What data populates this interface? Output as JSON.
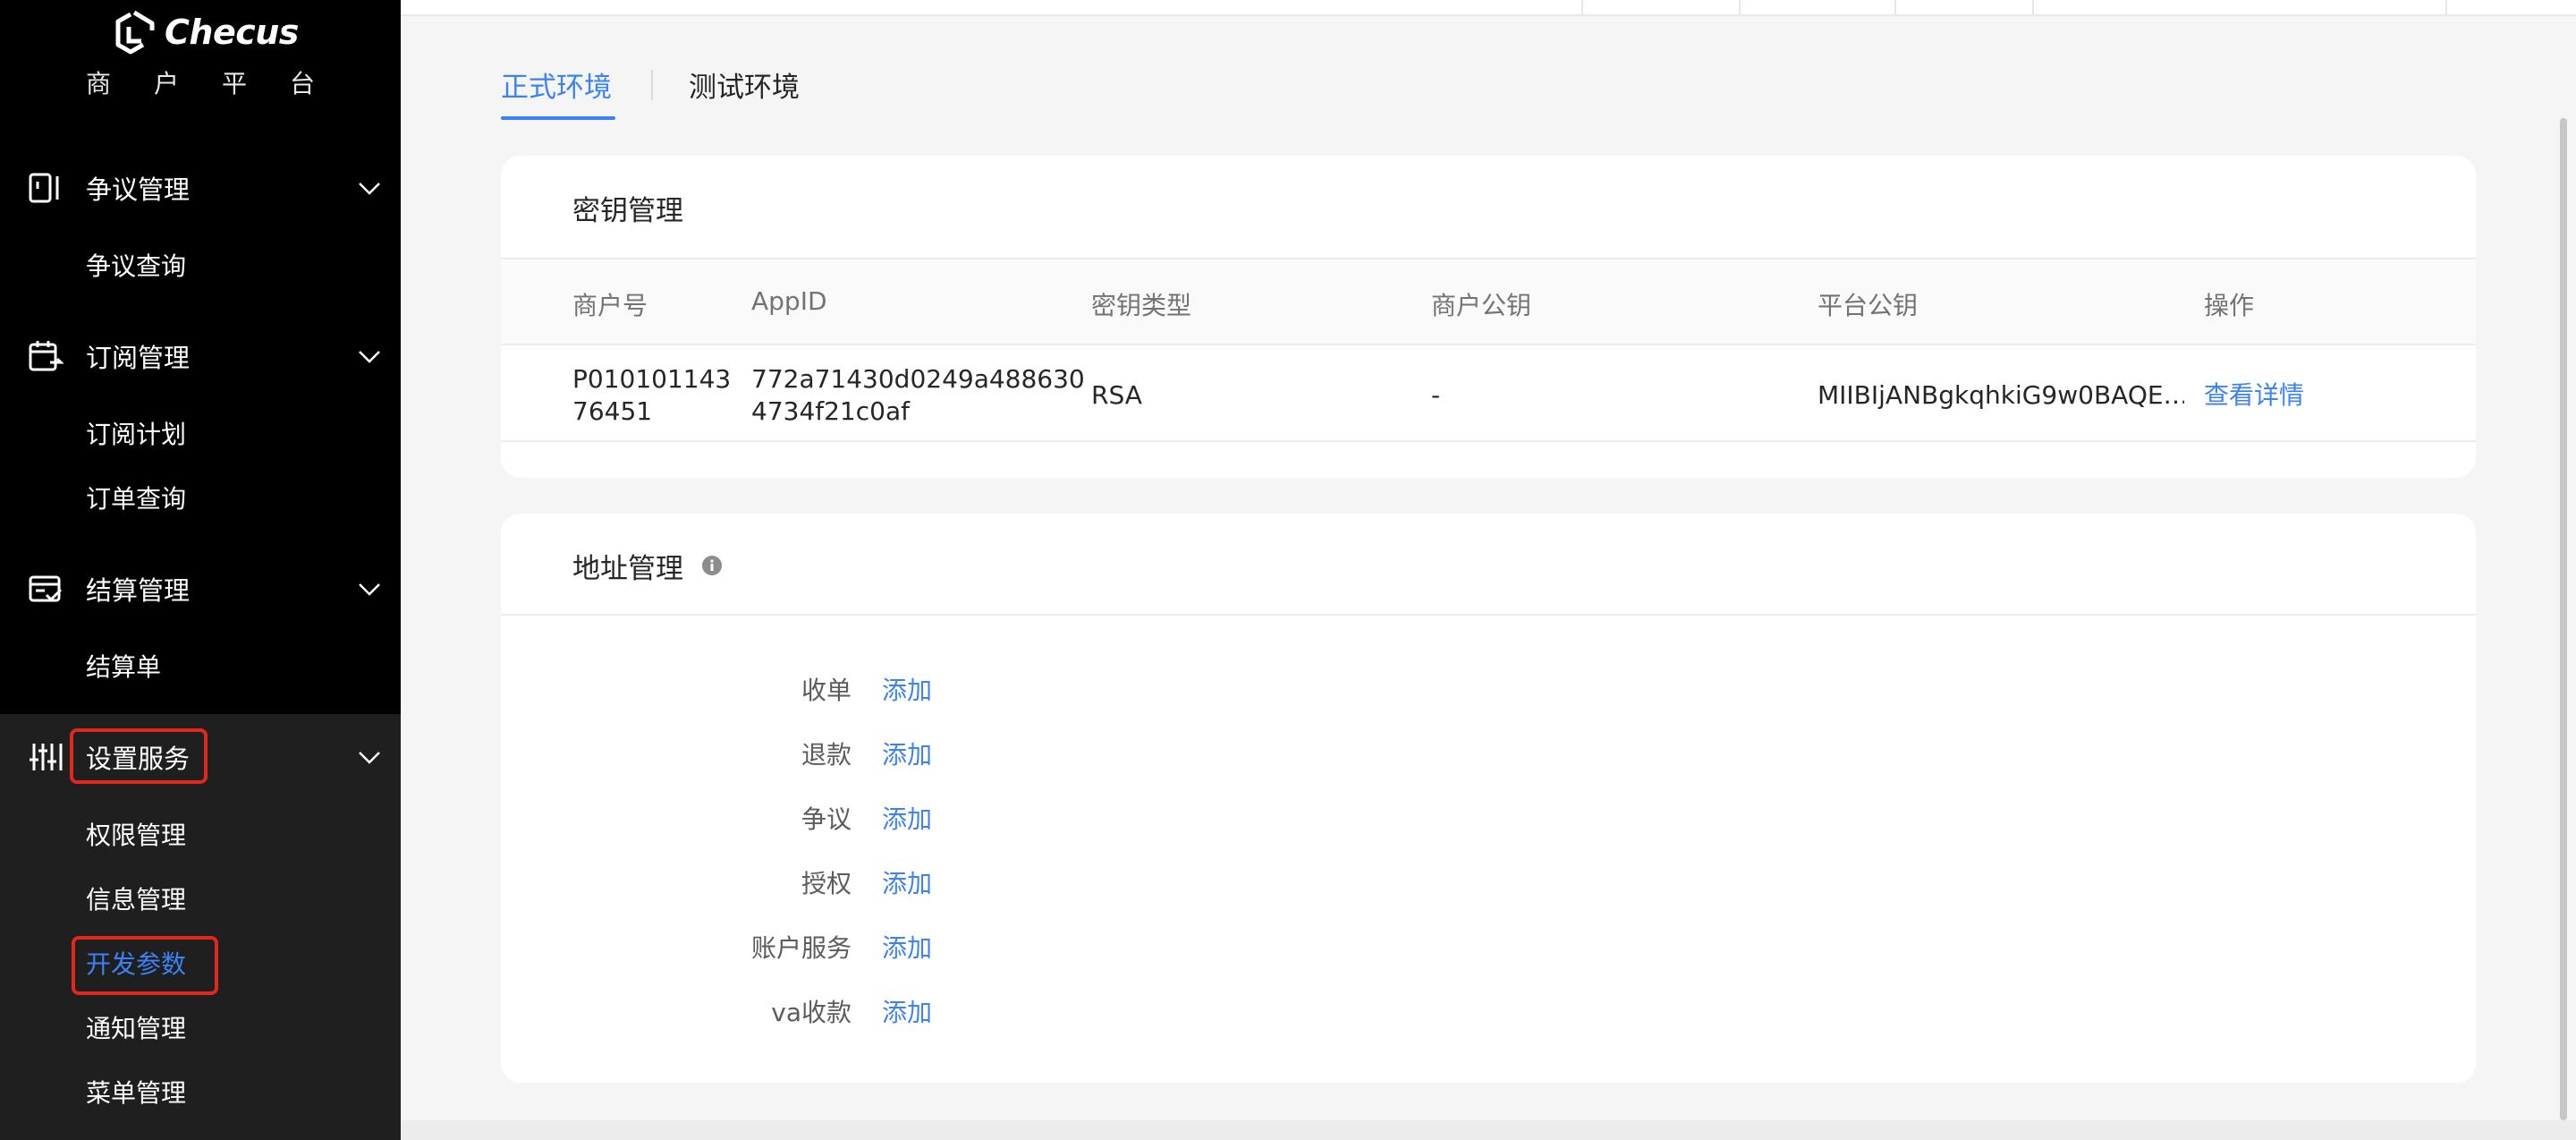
{
  "app": {
    "logo_text": "Checus",
    "subtitle": "商户平台"
  },
  "sidebar": {
    "groups": [
      {
        "label": "争议管理",
        "icon": "phone-doc-icon",
        "items": [
          "争议查询"
        ]
      },
      {
        "label": "订阅管理",
        "icon": "calendar-icon",
        "items": [
          "订阅计划",
          "订单查询"
        ]
      },
      {
        "label": "结算管理",
        "icon": "checklist-icon",
        "items": [
          "结算单"
        ]
      },
      {
        "label": "设置服务",
        "icon": "sliders-icon",
        "items": [
          "权限管理",
          "信息管理",
          "开发参数",
          "通知管理",
          "菜单管理"
        ]
      }
    ],
    "active_item": "开发参数"
  },
  "tabs": [
    {
      "label": "正式环境",
      "active": true
    },
    {
      "label": "测试环境",
      "active": false
    }
  ],
  "keys_card": {
    "title": "密钥管理",
    "columns": [
      "商户号",
      "AppID",
      "密钥类型",
      "商户公钥",
      "平台公钥",
      "操作"
    ],
    "rows": [
      {
        "merchant_no_line1": "P010101143",
        "merchant_no_line2": "76451",
        "appid_line1": "772a71430d0249a488630",
        "appid_line2": "4734f21c0af",
        "key_type": "RSA",
        "merchant_pubkey": "-",
        "platform_pubkey": "MIIBIjANBgkqhkiG9w0BAQE…",
        "action": "查看详情"
      }
    ]
  },
  "address_card": {
    "title": "地址管理",
    "rows": [
      {
        "label": "收单",
        "action": "添加"
      },
      {
        "label": "退款",
        "action": "添加"
      },
      {
        "label": "争议",
        "action": "添加"
      },
      {
        "label": "授权",
        "action": "添加"
      },
      {
        "label": "账户服务",
        "action": "添加"
      },
      {
        "label": "va收款",
        "action": "添加"
      }
    ]
  },
  "colors": {
    "accent": "#3b82f6",
    "highlight_box": "#e0281e",
    "sidebar_bg": "#000000"
  }
}
